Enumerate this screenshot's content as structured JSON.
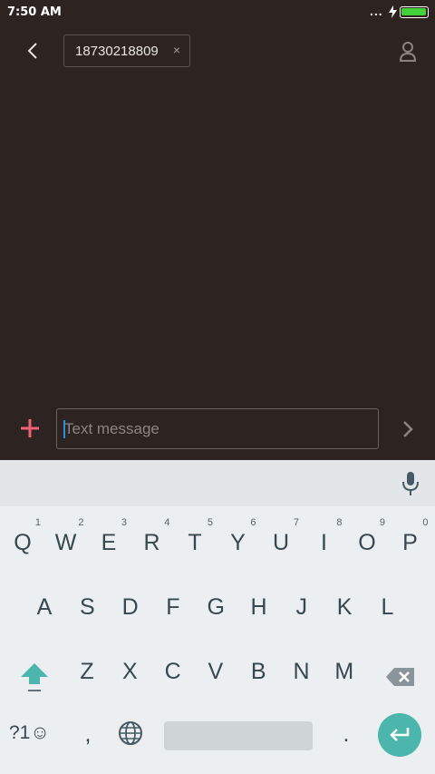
{
  "status_bar": {
    "time": "7:50 AM",
    "more": "...",
    "battery_level": 1.0
  },
  "header": {
    "recipient": "18730218809",
    "chip_close": "×"
  },
  "compose": {
    "placeholder": "Text message"
  },
  "keyboard": {
    "row1": [
      {
        "label": "Q",
        "hint": "1"
      },
      {
        "label": "W",
        "hint": "2"
      },
      {
        "label": "E",
        "hint": "3"
      },
      {
        "label": "R",
        "hint": "4"
      },
      {
        "label": "T",
        "hint": "5"
      },
      {
        "label": "Y",
        "hint": "6"
      },
      {
        "label": "U",
        "hint": "7"
      },
      {
        "label": "I",
        "hint": "8"
      },
      {
        "label": "O",
        "hint": "9"
      },
      {
        "label": "P",
        "hint": "0"
      }
    ],
    "row2": [
      "A",
      "S",
      "D",
      "F",
      "G",
      "H",
      "J",
      "K",
      "L"
    ],
    "row3": [
      "Z",
      "X",
      "C",
      "V",
      "B",
      "N",
      "M"
    ],
    "symbols_key": "?1☺",
    "comma_key": ",",
    "period_key": "."
  },
  "icons": {
    "back": "back-arrow-icon",
    "contact": "person-icon",
    "attach": "plus-icon",
    "send": "chevron-right-icon",
    "mic": "microphone-icon",
    "shift": "shift-icon",
    "backspace": "backspace-icon",
    "globe": "globe-icon",
    "enter": "enter-icon"
  },
  "colors": {
    "background": "#2d2320",
    "accent": "#4db6ac",
    "attach": "#f06277",
    "battery": "#43d13b"
  }
}
